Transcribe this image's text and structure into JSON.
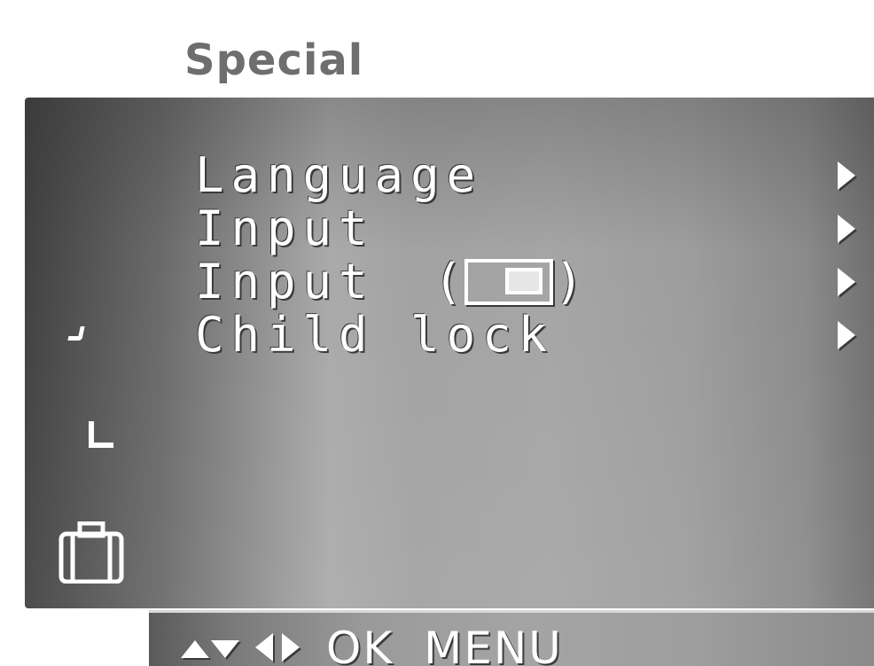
{
  "header": {
    "title": "Special"
  },
  "menu": {
    "items": [
      {
        "label": "Language",
        "has_submenu": true
      },
      {
        "label": "Input",
        "has_submenu": true
      },
      {
        "label": "Input",
        "paren_open": "(",
        "paren_close": ")",
        "icon": "pip-icon",
        "has_submenu": true
      },
      {
        "label": "Child lock",
        "has_submenu": true
      }
    ]
  },
  "sidebar": {
    "icons": [
      "check-icon",
      "corner-icon",
      "lock-icon"
    ]
  },
  "footer": {
    "ok_label": "OK",
    "menu_label": "MENU",
    "nav_icons": [
      "up-down-arrows-icon",
      "left-right-arrows-icon"
    ]
  },
  "colors": {
    "text": "#ffffff",
    "title": "#6e6e6e",
    "panel_dark": "#414141",
    "panel_light": "#aaaaaa"
  }
}
